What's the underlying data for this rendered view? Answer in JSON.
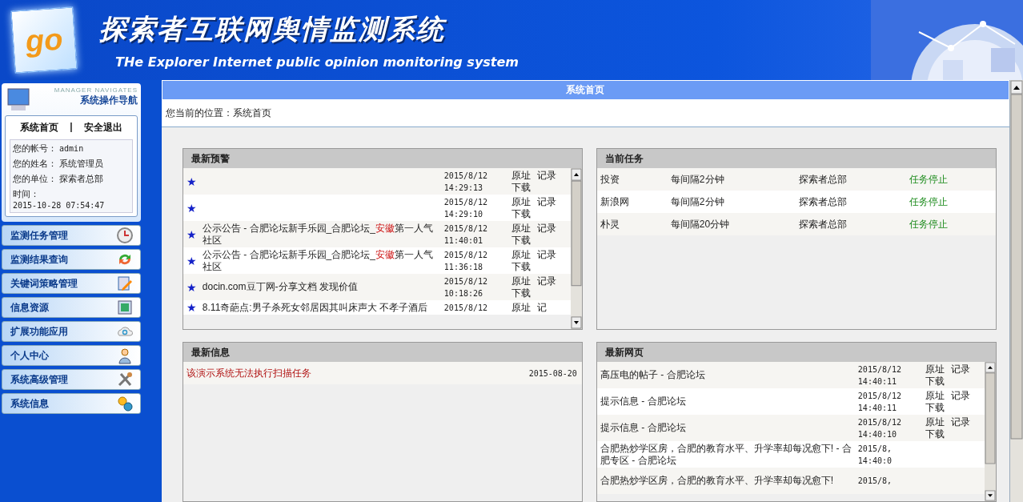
{
  "header": {
    "logo_text": "go",
    "title": "探索者互联网舆情监测系统",
    "subtitle": "THe Explorer Internet public opinion monitoring system"
  },
  "sidebar": {
    "caption": "MANAGER NAVIGATES",
    "title": "系统操作导航",
    "links": [
      "系统首页",
      "|",
      "安全退出"
    ],
    "info": [
      {
        "label": "您的帐号：",
        "value": "admin"
      },
      {
        "label": "您的姓名：",
        "value": "系统管理员"
      },
      {
        "label": "您的单位：",
        "value": "探索者总部"
      }
    ],
    "time_label": "时间：",
    "time_value": "2015-10-28 07:54:47",
    "menu": [
      {
        "label": "监测任务管理"
      },
      {
        "label": "监测结果查询"
      },
      {
        "label": "关键词策略管理"
      },
      {
        "label": "信息资源"
      },
      {
        "label": "扩展功能应用"
      },
      {
        "label": "个人中心"
      },
      {
        "label": "系统高级管理"
      },
      {
        "label": "系统信息"
      }
    ]
  },
  "main": {
    "title": "系统首页",
    "breadcrumb": "您当前的位置：系统首页",
    "alerts": {
      "title": "最新预警",
      "rows": [
        {
          "marker": "★",
          "before": "",
          "keyword": "",
          "after": "",
          "date": "2015/8/12",
          "time": "14:29:13",
          "links": [
            "原址",
            "记录",
            "下载"
          ]
        },
        {
          "marker": "★",
          "before": "",
          "keyword": "",
          "after": "",
          "date": "2015/8/12",
          "time": "14:29:10",
          "links": [
            "原址",
            "记录",
            "下载"
          ]
        },
        {
          "marker": "★",
          "before": "公示公告 - 合肥论坛新手乐园_合肥论坛_",
          "keyword": "安徽",
          "after": "第一人气社区",
          "date": "2015/8/12",
          "time": "11:40:01",
          "links": [
            "原址",
            "记录",
            "下载"
          ]
        },
        {
          "marker": "★",
          "before": "公示公告 - 合肥论坛新手乐园_合肥论坛_",
          "keyword": "安徽",
          "after": "第一人气社区",
          "date": "2015/8/12",
          "time": "11:36:18",
          "links": [
            "原址",
            "记录",
            "下载"
          ]
        },
        {
          "marker": "★",
          "before": "docin.com豆丁网-分享文档 发现价值",
          "keyword": "",
          "after": "",
          "date": "2015/8/12",
          "time": "10:18:26",
          "links": [
            "原址",
            "记录",
            "下载"
          ]
        },
        {
          "marker": "★",
          "before": "8.11奇葩点:男子杀死女邻居因其叫床声大 不孝子酒后",
          "keyword": "",
          "after": "",
          "date": "2015/8/12",
          "time": "",
          "links": [
            "原址",
            "记"
          ]
        }
      ]
    },
    "tasks": {
      "title": "当前任务",
      "rows": [
        {
          "name": "投资",
          "interval": "每间隔2分钟",
          "unit": "探索者总部",
          "status": "任务停止"
        },
        {
          "name": "新浪网",
          "interval": "每间隔2分钟",
          "unit": "探索者总部",
          "status": "任务停止"
        },
        {
          "name": "朴灵",
          "interval": "每间隔20分钟",
          "unit": "探索者总部",
          "status": "任务停止"
        }
      ]
    },
    "news": {
      "title": "最新信息",
      "rows": [
        {
          "text": "该演示系统无法执行扫描任务",
          "date": "2015-08-20"
        }
      ]
    },
    "pages": {
      "title": "最新网页",
      "rows": [
        {
          "title": "高压电的帖子 - 合肥论坛",
          "date": "2015/8/12",
          "time": "14:40:11",
          "links": [
            "原址",
            "记录",
            "下载"
          ]
        },
        {
          "title": "提示信息 - 合肥论坛",
          "date": "2015/8/12",
          "time": "14:40:11",
          "links": [
            "原址",
            "记录",
            "下载"
          ]
        },
        {
          "title": "提示信息 - 合肥论坛",
          "date": "2015/8/12",
          "time": "14:40:10",
          "links": [
            "原址",
            "记录",
            "下载"
          ]
        },
        {
          "title": "合肥热炒学区房，合肥的教育水平、升学率却每况愈下! - 合肥专区 - 合肥论坛",
          "date": "2015/8,",
          "time": "14:40:0",
          "links": []
        },
        {
          "title": "合肥热炒学区房，合肥的教育水平、升学率却每况愈下!",
          "date": "2015/8,",
          "time": "",
          "links": []
        }
      ]
    }
  }
}
